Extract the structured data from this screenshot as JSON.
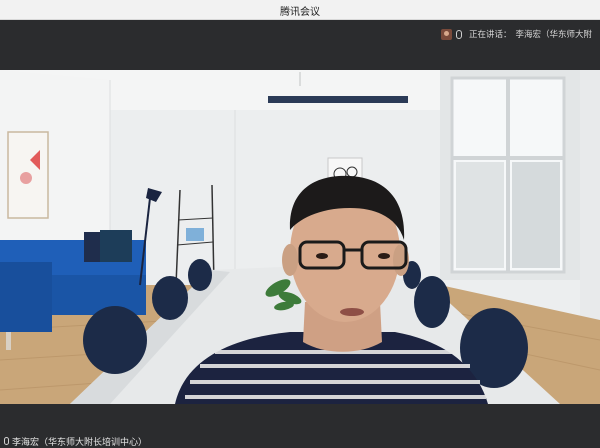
{
  "window": {
    "title": "腾讯会议"
  },
  "speaking": {
    "label": "正在讲话：",
    "speaker": "李海宏（华东师大附"
  },
  "participant": {
    "name": "李海宏（华东师大附长培训中心）"
  },
  "icons": {
    "mic": "mic-icon",
    "avatar": "avatar-icon"
  },
  "colors": {
    "chrome": "#2b2c2e",
    "titlebar": "#f2f2f2",
    "sofa": "#1f5fb8",
    "shirt": "#1c2340"
  }
}
